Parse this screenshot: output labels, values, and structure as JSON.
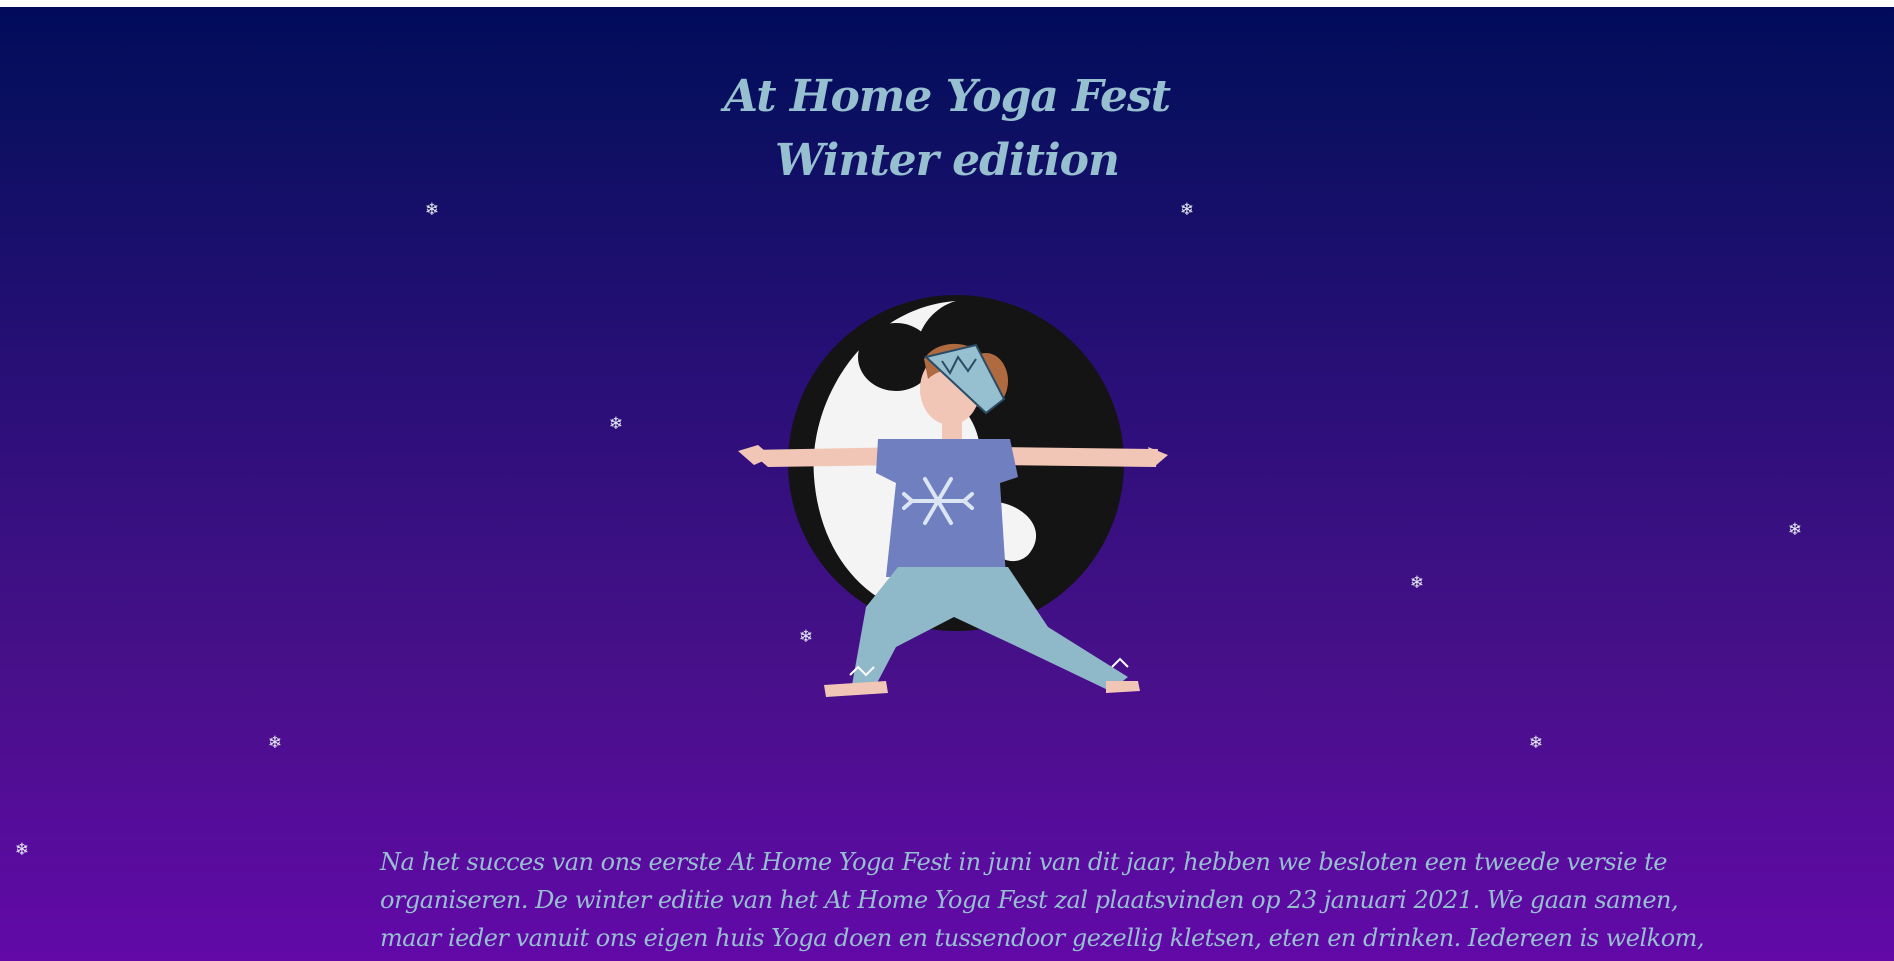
{
  "header": {
    "title_line1": "At Home Yoga Fest",
    "title_line2": "Winter edition"
  },
  "snowflake_glyph": "❄",
  "hero": {
    "icon": "yoga-warrior-yin-yang-illustration"
  },
  "intro": {
    "line1": "Na het succes van ons eerste At Home Yoga Fest in juni van dit jaar, hebben we besloten een tweede versie te",
    "line2": "organiseren. De winter editie van het At Home Yoga Fest zal plaatsvinden op 23 januari 2021. We gaan samen,",
    "line3": "maar ieder vanuit ons eigen huis Yoga doen en tussendoor gezellig kletsen, eten en drinken. Iedereen is welkom,"
  },
  "colors": {
    "background_top": "#010b5b",
    "background_bottom": "#6209a8",
    "text_accent": "#96bfcf",
    "snow": "#e6ecf4"
  }
}
